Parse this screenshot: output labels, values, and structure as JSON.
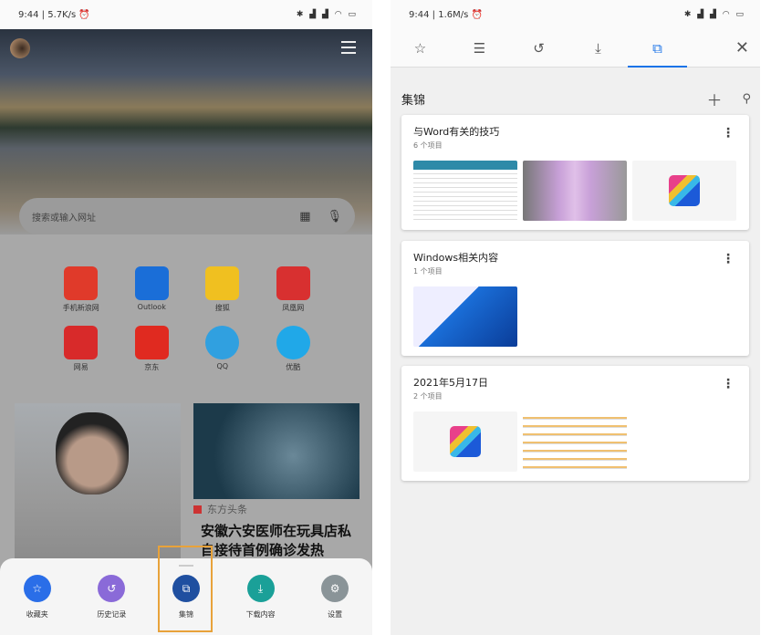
{
  "left": {
    "status": {
      "time": "9:44",
      "speed": "5.7K/s",
      "icons": "bluetooth signal signal wifi battery"
    },
    "search": {
      "placeholder": "搜索或输入网址",
      "qr_icon": "qr-code-icon",
      "mic_icon": "mic-icon"
    },
    "shortcuts": [
      {
        "label": "手机新浪网",
        "color": "#e03a2a"
      },
      {
        "label": "Outlook",
        "color": "#1a6ed8"
      },
      {
        "label": "搜狐",
        "color": "#f0c020"
      },
      {
        "label": "凤凰网",
        "color": "#d83030"
      },
      {
        "label": "网易",
        "color": "#d82a2a"
      },
      {
        "label": "京东",
        "color": "#e02a20"
      },
      {
        "label": "QQ",
        "color": "#30a0e0"
      },
      {
        "label": "优酷",
        "color": "#20a8e8"
      }
    ],
    "news": {
      "source": "东方头条",
      "headline": "安徽六安医师在玩具店私自接待首例确诊发热"
    },
    "sheet": [
      {
        "label": "收藏夹",
        "icon": "star-icon",
        "color": "#2a6ee8"
      },
      {
        "label": "历史记录",
        "icon": "history-icon",
        "color": "#8a6ad8"
      },
      {
        "label": "集锦",
        "icon": "collections-icon",
        "color": "#1f4fa0"
      },
      {
        "label": "下载内容",
        "icon": "download-icon",
        "color": "#1aa098"
      },
      {
        "label": "设置",
        "icon": "gear-icon",
        "color": "#8a9498"
      }
    ]
  },
  "right": {
    "status": {
      "time": "9:44",
      "speed": "1.6M/s",
      "icons": "bluetooth signal signal wifi battery"
    },
    "title": "集锦",
    "accent": "#1a73e8",
    "collections": [
      {
        "title": "与Word有关的技巧",
        "count": "6 个项目"
      },
      {
        "title": "Windows相关内容",
        "count": "1 个项目"
      },
      {
        "title": "2021年5月17日",
        "count": "2 个项目"
      }
    ]
  }
}
